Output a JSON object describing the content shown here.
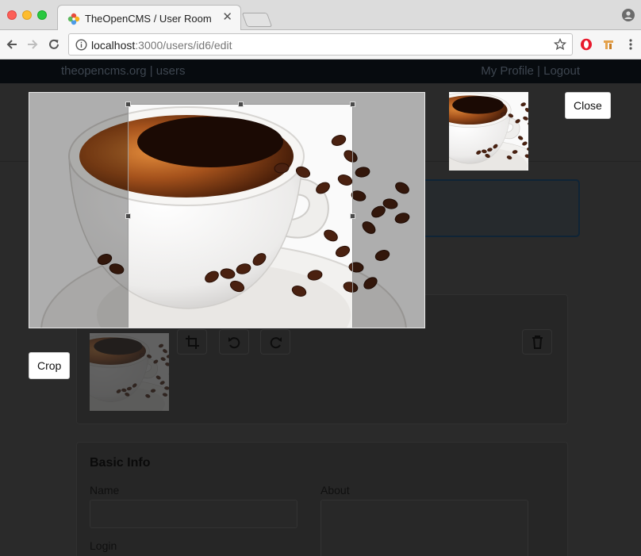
{
  "browser": {
    "tab_title": "TheOpenCMS / User Room",
    "url_host": "localhost",
    "url_rest": ":3000/users/id6/edit"
  },
  "site": {
    "brand": "theopencms.org | users",
    "links": "My Profile | Logout"
  },
  "modal": {
    "close_label": "Close",
    "crop_label": "Crop"
  },
  "form": {
    "section_title": "Basic Info",
    "name_label": "Name",
    "about_label": "About",
    "login_label": "Login"
  },
  "colors": {
    "overlay": "#2a2a2a",
    "site_nav": "#070b0f",
    "traffic_red": "#fc5f57",
    "traffic_yellow": "#fdbc2e",
    "traffic_green": "#29c840"
  }
}
